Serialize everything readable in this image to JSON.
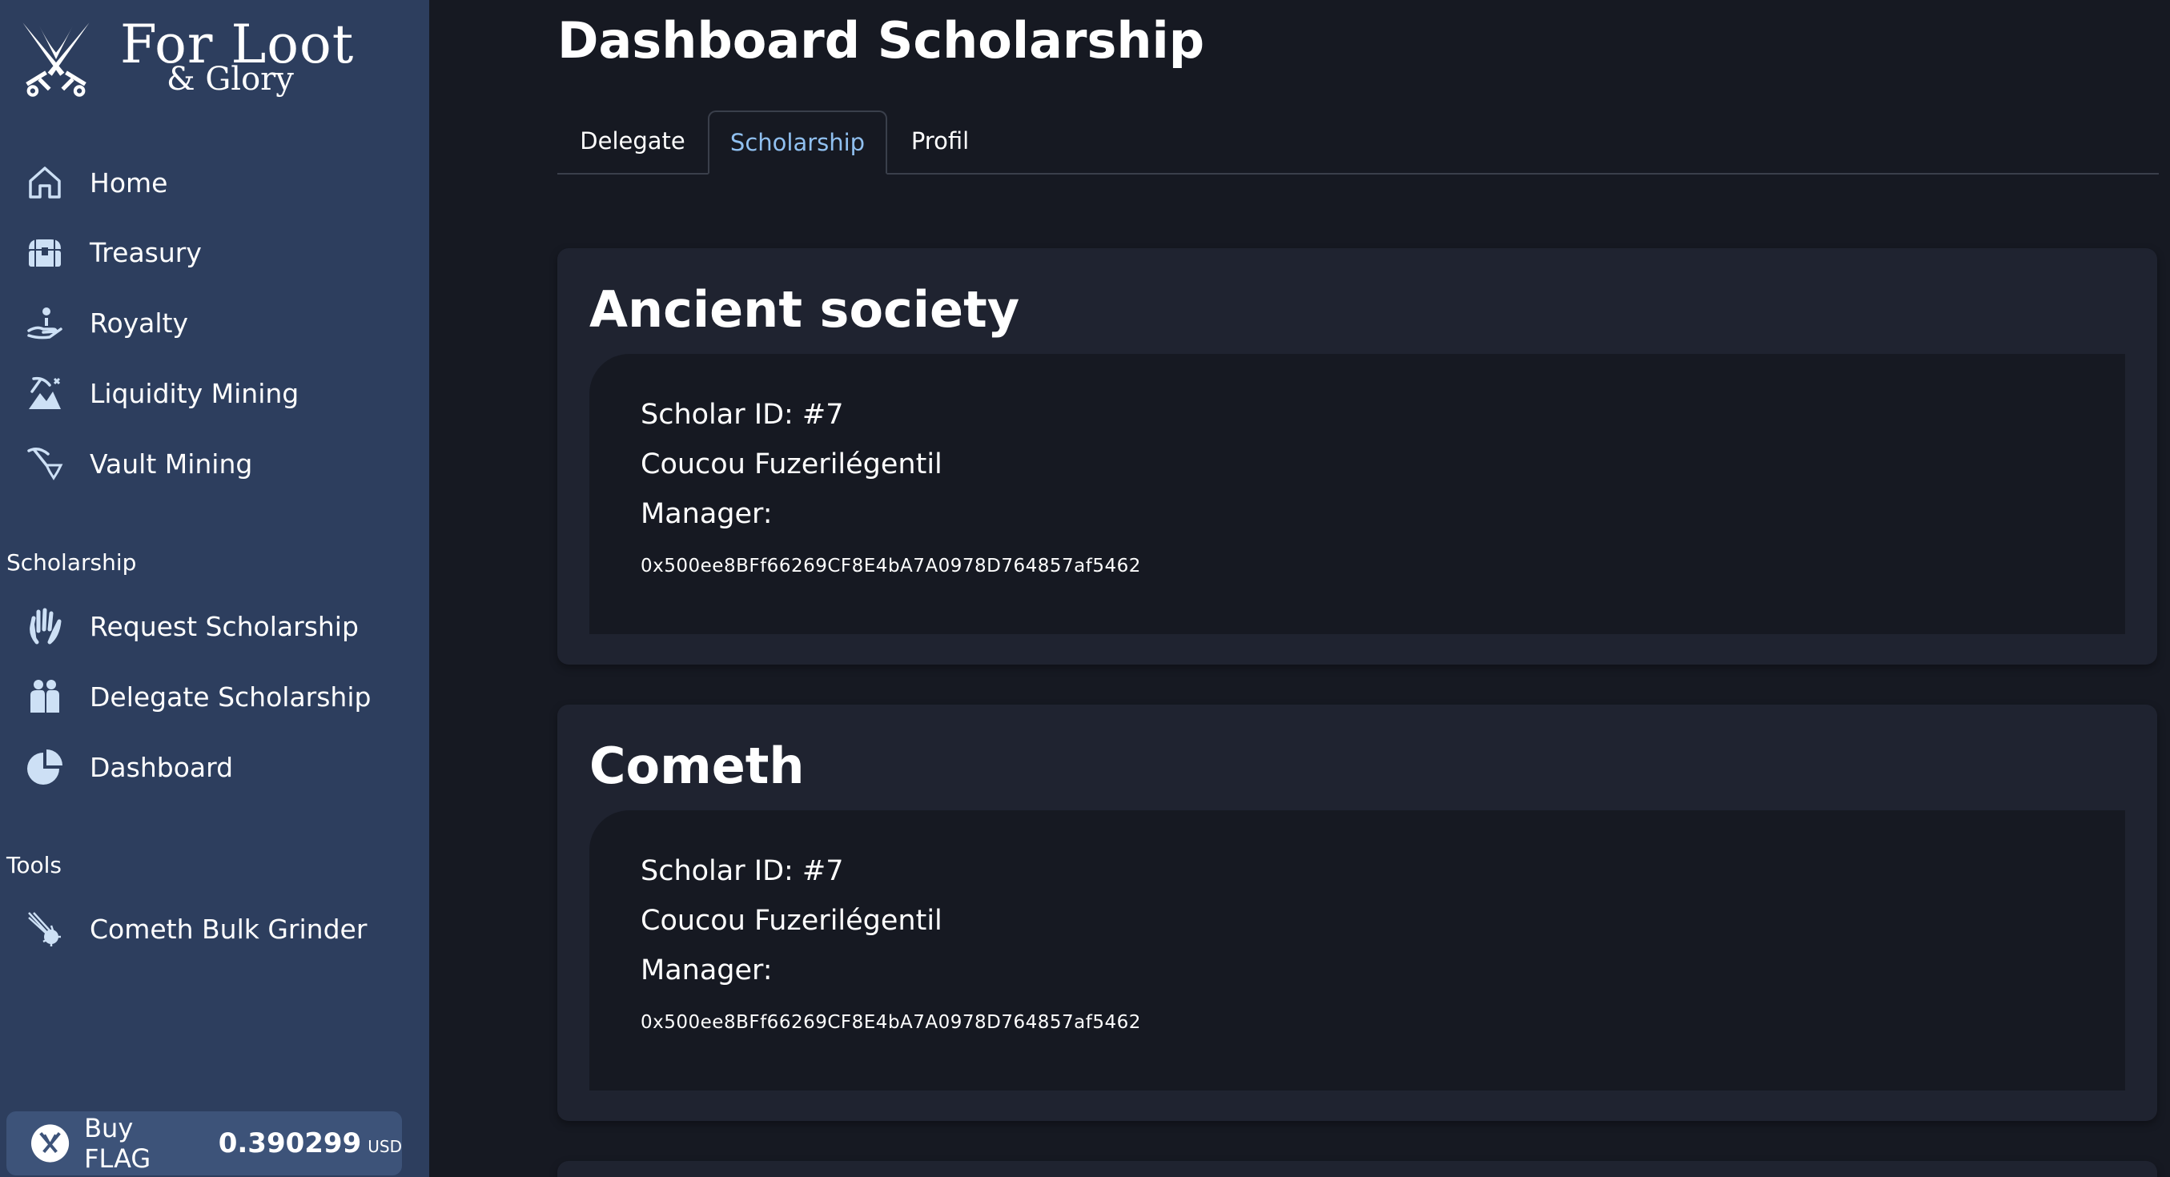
{
  "brand": {
    "title": "For Loot",
    "subtitle": "& Glory"
  },
  "sidebar": {
    "items": [
      {
        "label": "Home",
        "icon": "home-icon"
      },
      {
        "label": "Treasury",
        "icon": "treasure-chest-icon"
      },
      {
        "label": "Royalty",
        "icon": "hand-coin-icon"
      },
      {
        "label": "Liquidity Mining",
        "icon": "mining-icon"
      },
      {
        "label": "Vault Mining",
        "icon": "pickaxe-gem-icon"
      }
    ],
    "sections": [
      {
        "title": "Scholarship",
        "items": [
          {
            "label": "Request Scholarship",
            "icon": "raised-hand-icon"
          },
          {
            "label": "Delegate Scholarship",
            "icon": "people-icon"
          },
          {
            "label": "Dashboard",
            "icon": "pie-chart-icon"
          }
        ]
      },
      {
        "title": "Tools",
        "items": [
          {
            "label": "Cometh Bulk Grinder",
            "icon": "comet-icon"
          }
        ]
      }
    ],
    "buy": {
      "label": "Buy FLAG",
      "price": "0.390299",
      "unit": "USD"
    }
  },
  "main": {
    "title": "Dashboard Scholarship",
    "tabs": [
      {
        "label": "Delegate",
        "active": false
      },
      {
        "label": "Scholarship",
        "active": true
      },
      {
        "label": "Profil",
        "active": false
      }
    ],
    "cards": [
      {
        "title": "Ancient society",
        "scholar_id": "Scholar ID: #7",
        "name": "Coucou Fuzerilégentil",
        "manager_label": "Manager:",
        "manager_address": "0x500ee8BFf66269CF8E4bA7A0978D764857af5462"
      },
      {
        "title": "Cometh",
        "scholar_id": "Scholar ID: #7",
        "name": "Coucou Fuzerilégentil",
        "manager_label": "Manager:",
        "manager_address": "0x500ee8BFf66269CF8E4bA7A0978D764857af5462"
      }
    ]
  },
  "colors": {
    "sidebar_bg": "#2d3e5e",
    "main_bg": "#161922",
    "card_bg": "#1f2330",
    "active_tab": "#90c0f0"
  }
}
